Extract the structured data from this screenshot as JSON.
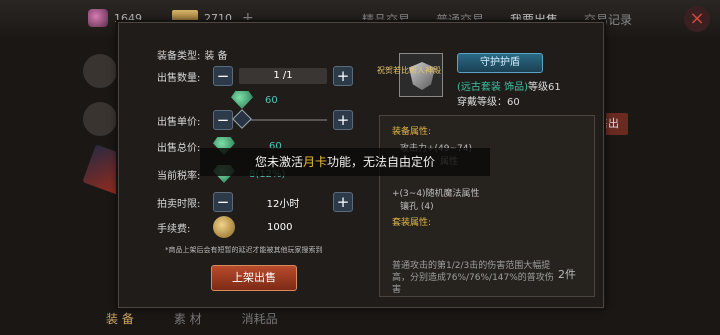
{
  "resources": {
    "gems": "1649",
    "gold": "2710",
    "plus": "+"
  },
  "top_tabs": [
    "精品交易",
    "普通交易",
    "我要出售",
    "交易记录"
  ],
  "close_glyph": "×",
  "bottom_tabs": [
    "装 备",
    "素 材",
    "消耗品"
  ],
  "side_button": "售出",
  "form": {
    "type_label": "装备类型:",
    "type_value": "装 备",
    "qty_label": "出售数量:",
    "qty_value": "1 /1",
    "price_top_value": "60",
    "unit_label": "出售单价:",
    "total_label": "出售总价:",
    "total_value": "60",
    "tax_label": "当前税率:",
    "tax_value": "8(12%)",
    "time_label": "拍卖时限:",
    "time_value": "12小时",
    "fee_label": "手续费:",
    "fee_value": "1000",
    "minus": "−",
    "plus": "+",
    "note": "*商品上架后会有短暂的延迟才能被其他玩家搜索到",
    "submit": "上架出售"
  },
  "item": {
    "name": "守护护盾",
    "set": "(远古套装 饰品)",
    "level": "等级61",
    "req_level": "穿戴等级：60",
    "overlay": "祝贺若比新人神殿"
  },
  "stats": {
    "attr_head": "装备属性:",
    "line1": "攻击力+(49~74)",
    "line1b": "属性",
    "line2": "+(3~4)随机魔法属性",
    "line3": "镶孔 (4)",
    "set_head": "套装属性:",
    "desc": "普通攻击的第1/2/3击的伤害范围大幅提高，分别造成76%/76%/147%的普攻伤害",
    "count": "2件"
  },
  "toast": {
    "before": "您未激活",
    "highlight": "月卡",
    "after": "功能，无法自由定价"
  },
  "colors": {
    "accent": "#e8c030",
    "teal": "#4fc4b8",
    "button_red": "#b94b2c"
  }
}
